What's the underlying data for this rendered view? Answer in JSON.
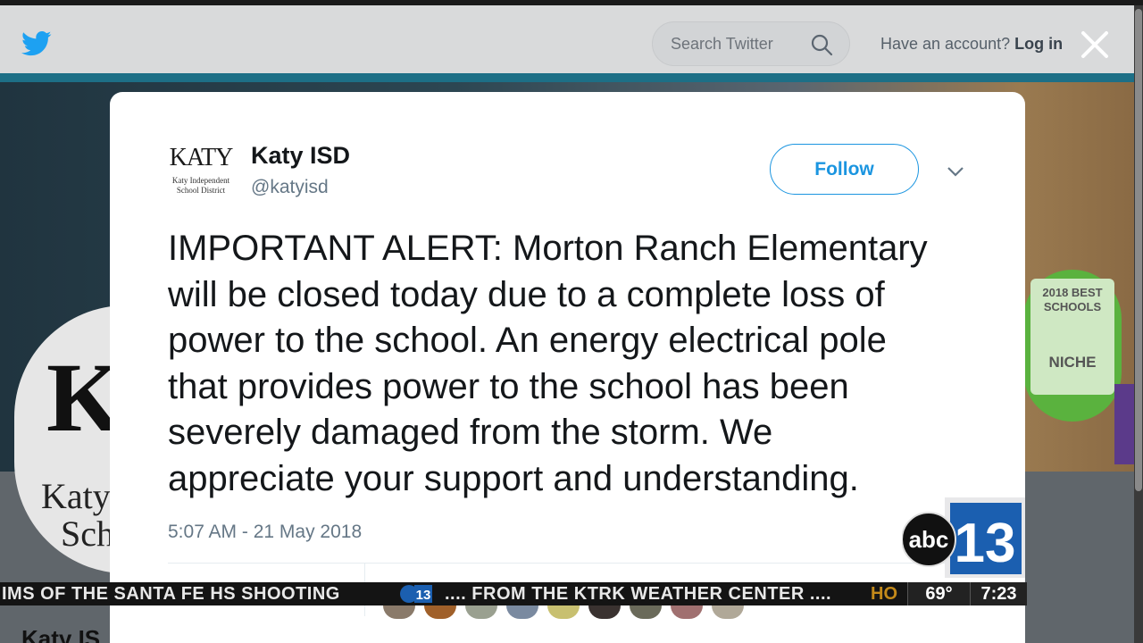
{
  "topbar": {
    "search_placeholder": "Search Twitter",
    "account_prompt": "Have an account?",
    "login_label": "Log in"
  },
  "background_profile": {
    "avatar_text_1": "Katy I",
    "avatar_text_2": "Sch",
    "badge_year_line": "2018 BEST",
    "badge_schools_line": "SCHOOLS",
    "badge_brand": "NICHE",
    "bottom_name": "Katy IS"
  },
  "tweet": {
    "logo_word": "KATY",
    "logo_sub_1": "Katy Independent",
    "logo_sub_2": "School District",
    "author_name": "Katy ISD",
    "author_handle": "@katyisd",
    "follow_label": "Follow",
    "text": "IMPORTANT ALERT: Morton Ranch Elementary\nwill be closed today due to a complete loss of\npower to the school. An energy electrical pole\nthat provides power to the school has been\nseverely damaged from the storm.  We\nappreciate your support and understanding.",
    "timestamp": "5:07 AM - 21 May 2018"
  },
  "broadcast": {
    "station_logo": "abc 13",
    "ticker_left": "IMS OF THE SANTA FE HS SHOOTING",
    "ticker_right": ".... FROM THE KTRK WEATHER CENTER ....",
    "ticker_fade": "HO",
    "temperature": "69°",
    "clock": "7:23"
  },
  "colors": {
    "twitter_blue": "#1b95e0",
    "text_primary": "#14171a",
    "text_secondary": "#657786"
  }
}
